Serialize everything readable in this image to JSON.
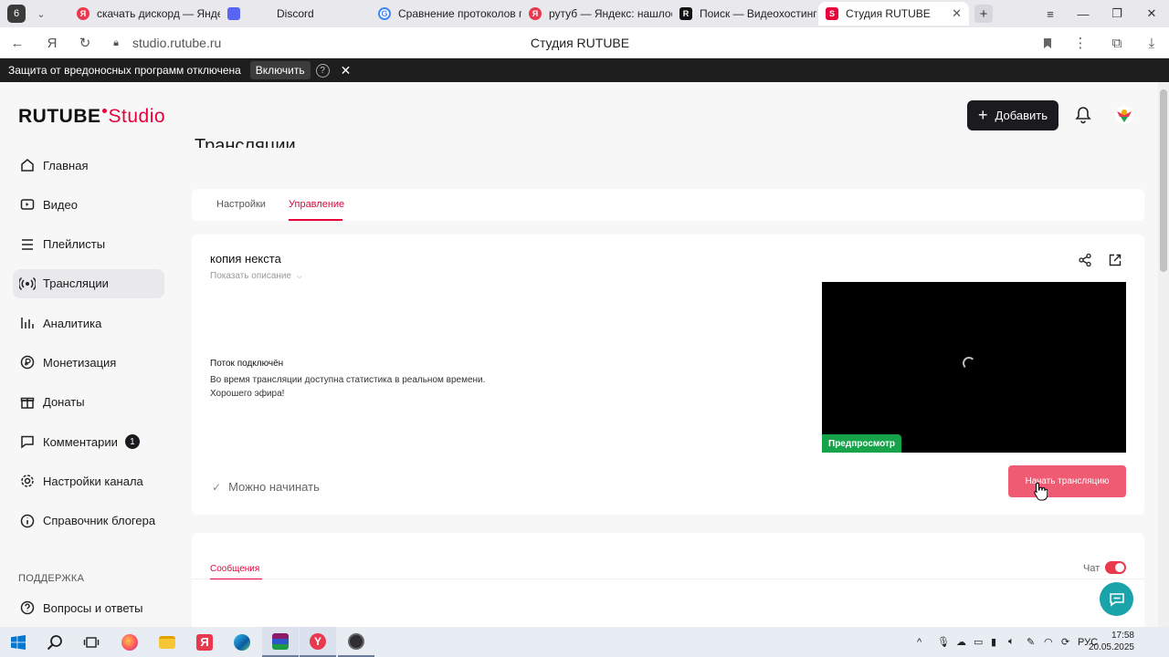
{
  "browser": {
    "tab_count": "6",
    "tabs": [
      {
        "title": "скачать дискорд — Яндекс",
        "icon": "yandex-icon",
        "color": "#e8394f"
      },
      {
        "title": "Discord",
        "icon": "discord-icon",
        "color": "#5865f2"
      },
      {
        "title": "Сравнение протоколов п",
        "icon": "google-icon",
        "color": "#4285f4"
      },
      {
        "title": "рутуб — Яндекс: нашлось",
        "icon": "yandex-icon",
        "color": "#e8394f"
      },
      {
        "title": "Поиск — Видеохостинг R",
        "icon": "rutube-icon",
        "color": "#111111"
      },
      {
        "title": "Студия RUTUBE",
        "icon": "rutube-studio-icon",
        "color": "#e8003c"
      }
    ],
    "url": "studio.rutube.ru",
    "page_title": "Студия RUTUBE",
    "security_notice": {
      "message": "Защита от вредоносных программ отключена",
      "action": "Включить",
      "help": "?"
    }
  },
  "app": {
    "logo_main": "RUTUBE",
    "logo_studio": "Studio",
    "add_button": "Добавить",
    "sidebar": {
      "items": [
        {
          "label": "Главная",
          "icon": "home-icon"
        },
        {
          "label": "Видео",
          "icon": "video-icon"
        },
        {
          "label": "Плейлисты",
          "icon": "playlist-icon"
        },
        {
          "label": "Трансляции",
          "icon": "broadcast-icon",
          "active": true
        },
        {
          "label": "Аналитика",
          "icon": "analytics-icon"
        },
        {
          "label": "Монетизация",
          "icon": "monetization-icon"
        },
        {
          "label": "Донаты",
          "icon": "donate-icon"
        },
        {
          "label": "Комментарии",
          "icon": "comments-icon",
          "badge": "1"
        },
        {
          "label": "Настройки канала",
          "icon": "settings-icon"
        },
        {
          "label": "Справочник блогера",
          "icon": "info-icon"
        }
      ],
      "support_header": "ПОДДЕРЖКА",
      "support_items": [
        {
          "label": "Вопросы и ответы",
          "icon": "faq-icon"
        }
      ]
    },
    "page_heading": "Трансляции",
    "tabs": [
      {
        "label": "Настройки"
      },
      {
        "label": "Управление",
        "active": true
      }
    ],
    "stream": {
      "name": "копия некста",
      "show_description": "Показать описание",
      "status_title": "Поток подключён",
      "status_line1": "Во время трансляции доступна статистика в реальном времени.",
      "status_line2": "Хорошего эфира!",
      "preview_label": "Предпросмотр",
      "ready_text": "Можно начинать",
      "start_button": "Начать трансляцию"
    },
    "chat": {
      "messages_tab": "Сообщения",
      "chat_label": "Чат",
      "chat_enabled": true
    },
    "accent_color": "#e8003c"
  },
  "taskbar": {
    "language": "РУС",
    "time": "17:58",
    "date": "20.05.2025"
  }
}
